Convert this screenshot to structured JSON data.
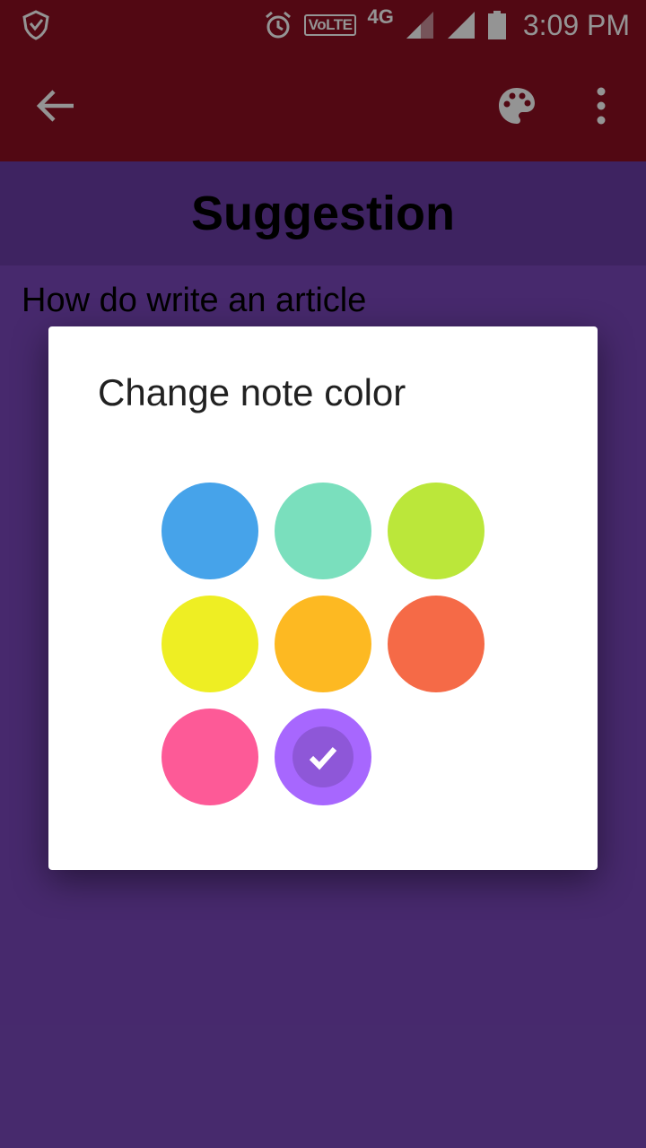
{
  "status_bar": {
    "volte": "VoLTE",
    "network": "4G",
    "time": "3:09 PM",
    "icons": [
      "shield-icon",
      "alarm-icon",
      "signal-icon",
      "battery-icon"
    ]
  },
  "toolbar": {
    "icons": [
      "back-arrow-icon",
      "palette-icon",
      "more-vert-icon"
    ]
  },
  "note": {
    "title": "Suggestion",
    "body": "How do write an article"
  },
  "dialog": {
    "title": "Change note color",
    "colors": [
      "#46a3ea",
      "#7adfbd",
      "#bbe73a",
      "#eeee23",
      "#fdb922",
      "#f56a47",
      "#fd5a97",
      "#a767fe"
    ],
    "selected_index": 7
  }
}
